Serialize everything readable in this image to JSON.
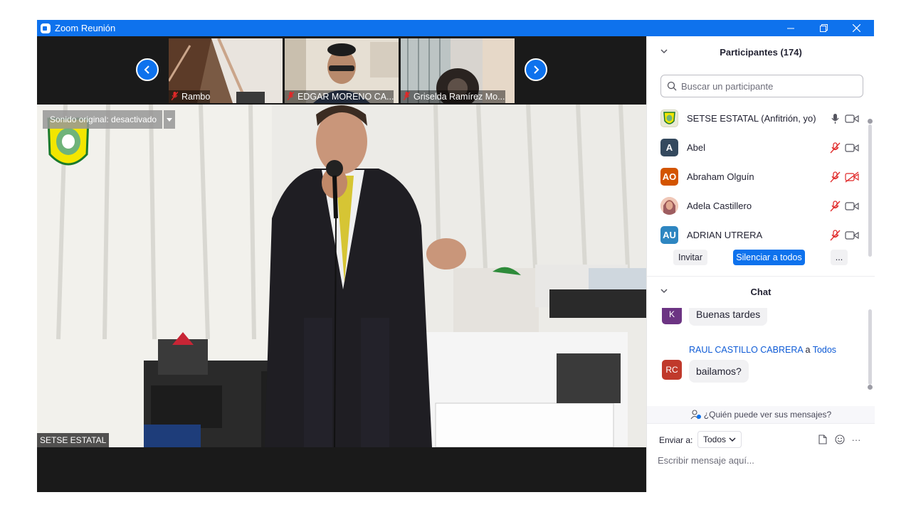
{
  "window": {
    "title": "Zoom Reunión",
    "minimize_icon": "minimize-icon",
    "restore_icon": "restore-icon",
    "close_icon": "close-icon"
  },
  "thumbnails": [
    {
      "name": "Rambo",
      "muted": true
    },
    {
      "name": "EDGAR MORENO CA...",
      "muted": true
    },
    {
      "name": "Griselda Ramírez Mo...",
      "muted": true
    }
  ],
  "main_video": {
    "sound_label": "Sonido original: desactivado",
    "speaker_label": "SETSE ESTATAL"
  },
  "participants": {
    "header": "Participantes (174)",
    "search_placeholder": "Buscar un participante",
    "list": [
      {
        "avatar_text": "",
        "avatar_color": "#e9e9d5",
        "name": "SETSE ESTATAL (Anfitrión, yo)",
        "mic": "on",
        "cam": "on"
      },
      {
        "avatar_text": "A",
        "avatar_color": "#34495e",
        "name": "Abel",
        "mic": "muted",
        "cam": "on"
      },
      {
        "avatar_text": "AO",
        "avatar_color": "#d35400",
        "name": "Abraham Olguín",
        "mic": "muted",
        "cam": "off"
      },
      {
        "avatar_text": "",
        "avatar_color": "#e8b7a4",
        "name": "Adela Castillero",
        "mic": "muted",
        "cam": "on"
      },
      {
        "avatar_text": "AU",
        "avatar_color": "#2e86c1",
        "name": "ADRIAN UTRERA",
        "mic": "muted",
        "cam": "on"
      }
    ],
    "invite_label": "Invitar",
    "mute_all_label": "Silenciar a todos",
    "more_label": "..."
  },
  "chat": {
    "header": "Chat",
    "messages": [
      {
        "avatar_text": "K",
        "avatar_color": "#6c3483",
        "sender": "",
        "text": "Buenas tardes"
      },
      {
        "avatar_text": "RC",
        "avatar_color": "#c0392b",
        "sender": "RAUL CASTILLO CABRERA",
        "recipient_sep": " a ",
        "recipient": "Todos",
        "text": "bailamos?"
      }
    ],
    "who_can_see": "¿Quién puede ver sus mensajes?",
    "send_to_label": "Enviar a:",
    "send_to_value": "Todos",
    "input_placeholder": "Escribir mensaje aquí...",
    "more_label": "···"
  },
  "colors": {
    "accent": "#0e72ed",
    "titlebar": "#0e72ed",
    "muted_icon": "#e02828"
  }
}
